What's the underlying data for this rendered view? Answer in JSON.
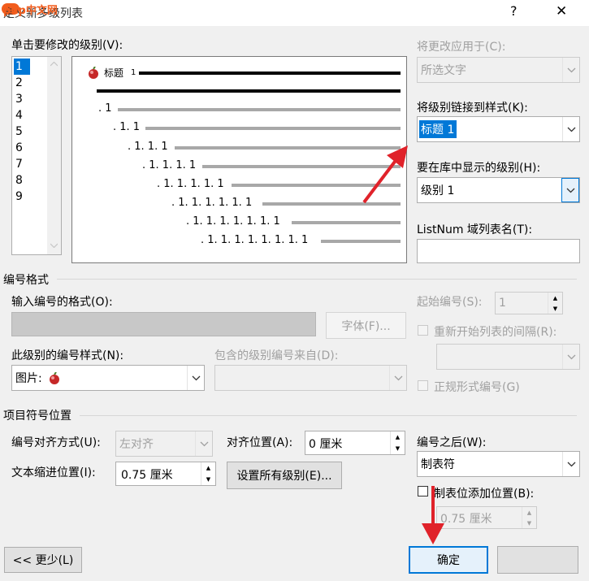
{
  "window": {
    "title": "定义新多级列表",
    "watermark": "php中文网",
    "help_glyph": "?",
    "close_glyph": "✕"
  },
  "level_list": {
    "label": "单击要修改的级别(V):",
    "items": [
      "1",
      "2",
      "3",
      "4",
      "5",
      "6",
      "7",
      "8",
      "9"
    ],
    "selected": "1"
  },
  "preview": {
    "heading_text": "标题",
    "heading_num": "1",
    "rows": [
      ". 1",
      ". 1. 1",
      ". 1. 1. 1",
      ". 1. 1. 1. 1",
      ". 1. 1. 1. 1. 1",
      ". 1. 1. 1. 1. 1. 1",
      ". 1. 1. 1. 1. 1. 1. 1",
      ". 1. 1. 1. 1. 1. 1. 1. 1"
    ]
  },
  "right_panel": {
    "apply_to_label": "将更改应用于(C):",
    "apply_to_value": "所选文字",
    "link_style_label": "将级别链接到样式(K):",
    "link_style_value": "标题 1",
    "gallery_level_label": "要在库中显示的级别(H):",
    "gallery_level_value": "级别 1",
    "listnum_label": "ListNum 域列表名(T):",
    "listnum_value": ""
  },
  "number_format": {
    "section_label": "编号格式",
    "input_label": "输入编号的格式(O):",
    "input_value": "",
    "font_button": "字体(F)...",
    "style_label": "此级别的编号样式(N):",
    "style_value": "图片:",
    "include_label": "包含的级别编号来自(D):",
    "include_value": "",
    "start_label": "起始编号(S):",
    "start_value": "1",
    "restart_label": "重新开始列表的间隔(R):",
    "restart_value": "",
    "legal_label": "正规形式编号(G)"
  },
  "position": {
    "section_label": "项目符号位置",
    "align_label": "编号对齐方式(U):",
    "align_value": "左对齐",
    "align_at_label": "对齐位置(A):",
    "align_at_value": "0 厘米",
    "indent_label": "文本缩进位置(I):",
    "indent_value": "0.75 厘米",
    "set_all_button": "设置所有级别(E)...",
    "follow_label": "编号之后(W):",
    "follow_value": "制表符",
    "add_tab_label": "制表位添加位置(B):",
    "add_tab_value": "0.75 厘米"
  },
  "footer": {
    "less_button": "<< 更少(L)",
    "ok_button": "确定"
  },
  "colors": {
    "accent_selected": "#0078d7",
    "annotation_arrow": "#e0222a"
  }
}
